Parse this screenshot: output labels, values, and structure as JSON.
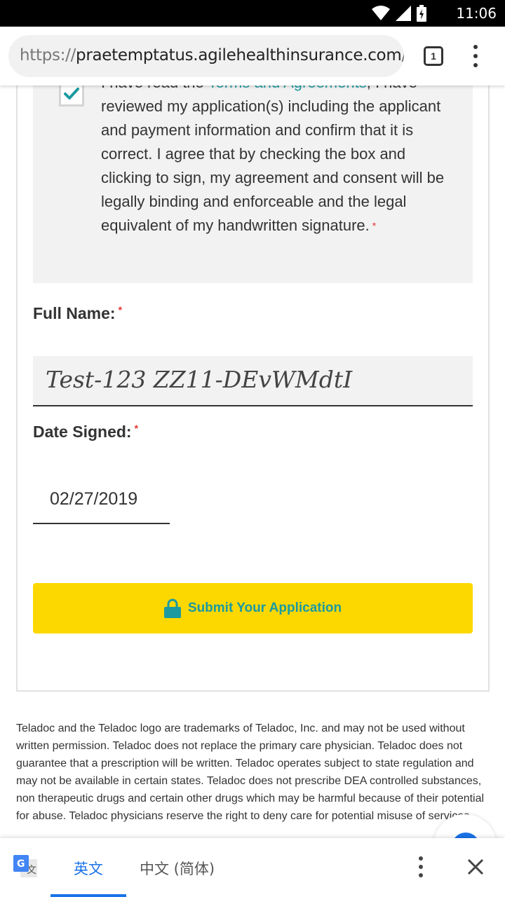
{
  "status_bar": {
    "time": "11:06"
  },
  "browser": {
    "url_scheme": "https://",
    "url_host": "praetemptatus.agilehealthinsurance.com",
    "url_path": "/t",
    "tab_count": "1"
  },
  "agreement": {
    "checked": true,
    "text_prefix": "I have read the ",
    "link_text": "Terms and Agreements",
    "text_suffix": ", I have reviewed my application(s) including the applicant and payment information and confirm that it is correct. I agree that by checking the box and clicking to sign, my agreement and consent will be legally binding and enforceable and the legal equivalent of my handwritten signature.",
    "required_marker": "*"
  },
  "form": {
    "full_name_label": "Full Name:",
    "full_name_value": "Test-123 ZZ11-DEvWMdtI",
    "date_signed_label": "Date Signed:",
    "date_signed_value": "02/27/2019",
    "required_marker": "*"
  },
  "submit": {
    "label": "Submit Your Application"
  },
  "footer": {
    "disclaimer": "Teladoc and the Teladoc logo are trademarks of Teladoc, Inc. and may not be used without written permission. Teladoc does not replace the primary care physician. Teladoc does not guarantee that a prescription will be written. Teladoc operates subject to state regulation and may not be available in certain states. Teladoc does not prescribe DEA controlled substances, non therapeutic drugs and certain other drugs which may be harmful because of their potential for abuse. Teladoc physicians reserve the right to deny care for potential misuse of services."
  },
  "translate_bar": {
    "source_lang": "英文",
    "target_lang": "中文 (简体)"
  },
  "colors": {
    "accent_teal": "#1b9aa0",
    "button_yellow": "#fdd800",
    "required_red": "#e3342f",
    "translate_blue": "#1a73e8"
  }
}
